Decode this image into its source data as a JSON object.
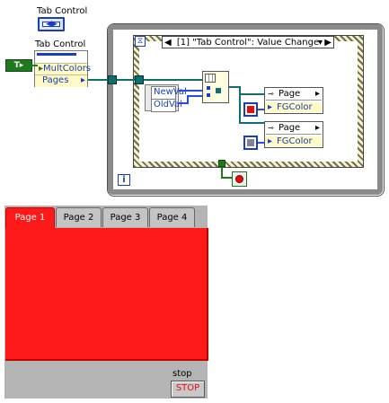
{
  "diagram": {
    "tab_control_terminal_label": "Tab Control",
    "terminal_glyph": "◀▶",
    "property_node": {
      "label": "Tab Control",
      "properties": [
        "MultColors",
        "Pages"
      ],
      "const_label": "T"
    },
    "event_structure": {
      "selector": "[1] \"Tab Control\": Value Change",
      "event_data": [
        "NewVal",
        "OldVal"
      ]
    },
    "page_nodes": [
      {
        "top": "Page",
        "property": "FGColor",
        "const_color": "#e01010"
      },
      {
        "top": "Page",
        "property": "FGColor",
        "const_color": "#8080a0"
      }
    ],
    "iteration_label": "i"
  },
  "front_panel": {
    "tabs": [
      "Page 1",
      "Page 2",
      "Page 3",
      "Page 4"
    ],
    "active_tab_index": 0,
    "page_color": "#ff1a1a",
    "stop_label": "stop",
    "stop_button_text": "STOP"
  }
}
